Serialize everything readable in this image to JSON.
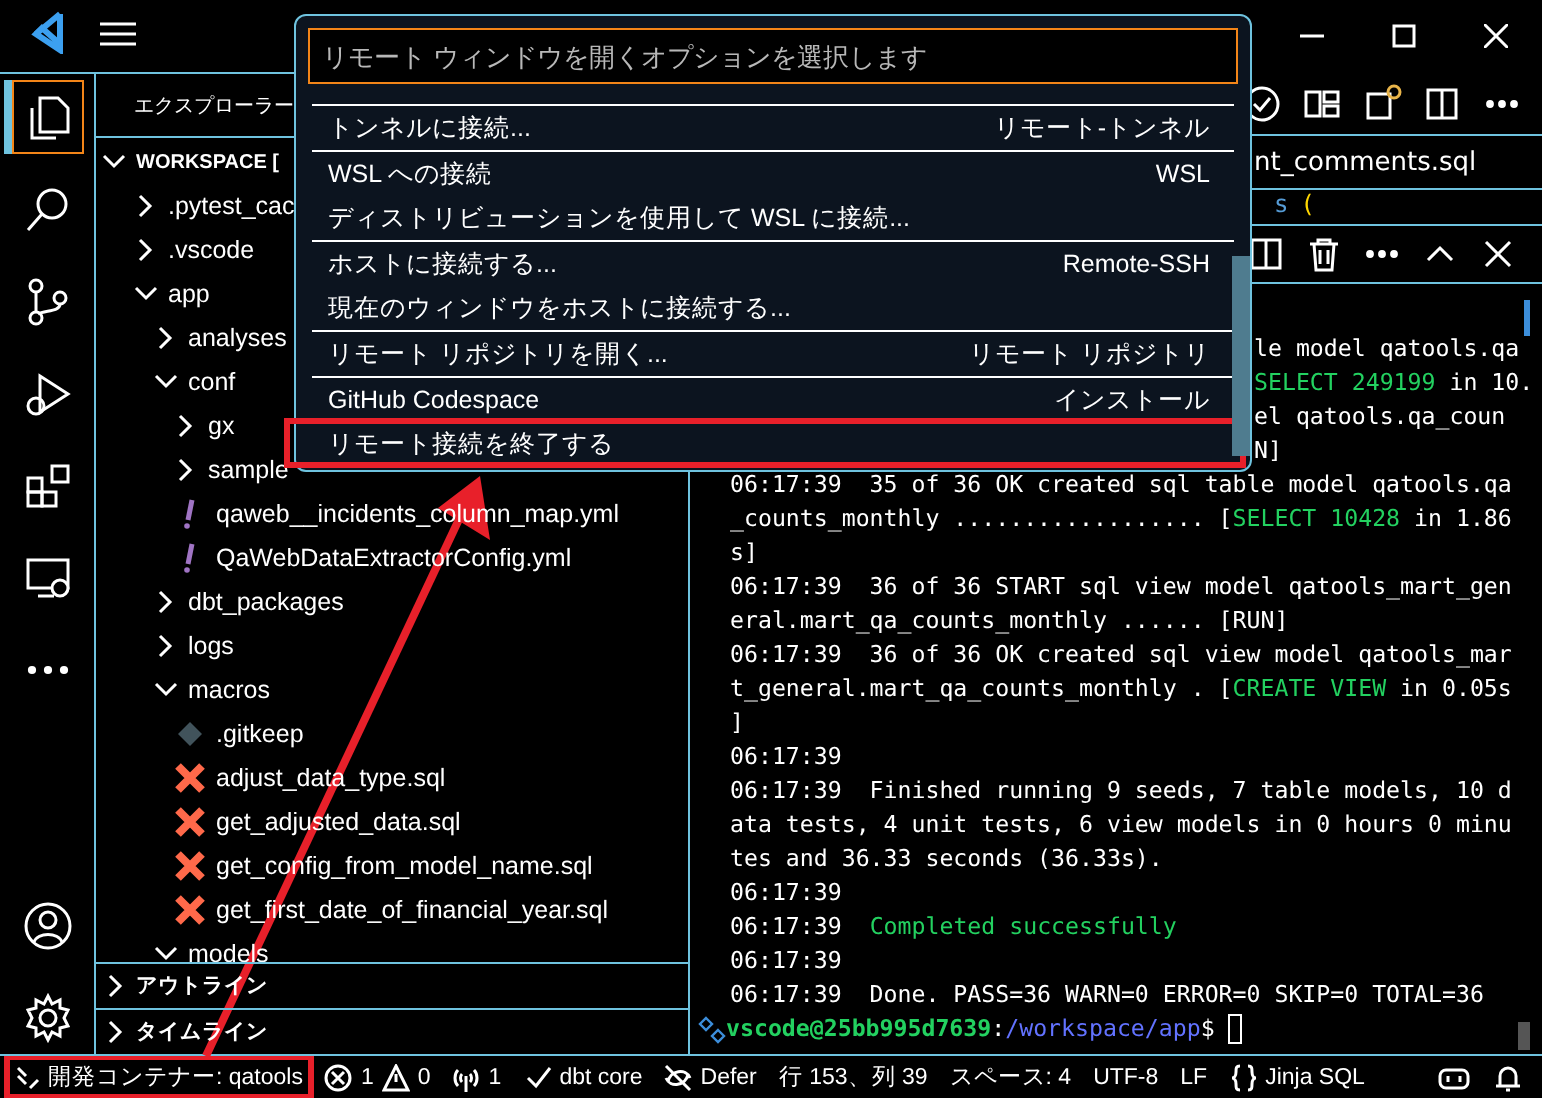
{
  "activity_bar": {
    "items": [
      {
        "kind": "explorer",
        "selected": true
      },
      {
        "kind": "search",
        "selected": false
      },
      {
        "kind": "source-control",
        "selected": false
      },
      {
        "kind": "run-debug",
        "selected": false
      },
      {
        "kind": "extensions",
        "selected": false
      },
      {
        "kind": "remote",
        "selected": false
      },
      {
        "kind": "more",
        "selected": false
      }
    ],
    "bottom": [
      {
        "kind": "account"
      },
      {
        "kind": "settings"
      }
    ]
  },
  "sidebar": {
    "title": "エクスプローラー",
    "tree": [
      {
        "label": "WORKSPACE [",
        "kind": "root",
        "expanded": true,
        "children": [
          {
            "label": ".pytest_cac",
            "kind": "folder",
            "expanded": false
          },
          {
            "label": ".vscode",
            "kind": "folder",
            "expanded": false
          },
          {
            "label": "app",
            "kind": "folder",
            "expanded": true,
            "children": [
              {
                "label": "analyses",
                "kind": "folder",
                "expanded": false
              },
              {
                "label": "conf",
                "kind": "folder",
                "expanded": true,
                "children": [
                  {
                    "label": "gx",
                    "kind": "folder",
                    "expanded": false
                  },
                  {
                    "label": "sample",
                    "kind": "folder",
                    "expanded": false
                  },
                  {
                    "label": "qaweb__incidents_column_map.yml",
                    "kind": "yaml"
                  },
                  {
                    "label": "QaWebDataExtractorConfig.yml",
                    "kind": "yaml"
                  }
                ]
              },
              {
                "label": "dbt_packages",
                "kind": "folder",
                "expanded": false
              },
              {
                "label": "logs",
                "kind": "folder",
                "expanded": false
              },
              {
                "label": "macros",
                "kind": "folder",
                "expanded": true,
                "children": [
                  {
                    "label": ".gitkeep",
                    "kind": "gitkeep"
                  },
                  {
                    "label": "adjust_data_type.sql",
                    "kind": "dbt"
                  },
                  {
                    "label": "get_adjusted_data.sql",
                    "kind": "dbt"
                  },
                  {
                    "label": "get_config_from_model_name.sql",
                    "kind": "dbt"
                  },
                  {
                    "label": "get_first_date_of_financial_year.sql",
                    "kind": "dbt"
                  }
                ]
              },
              {
                "label": "models",
                "kind": "folder",
                "expanded": true
              }
            ]
          }
        ]
      }
    ],
    "sections": [
      {
        "label": "アウトライン",
        "expanded": false
      },
      {
        "label": "タイムライン",
        "expanded": false
      }
    ]
  },
  "editor": {
    "tab": {
      "label": "nt_comments.sql"
    },
    "code": [
      {
        "text": "s",
        "kind": "keyword"
      },
      {
        "text": "(",
        "kind": "bracket"
      }
    ]
  },
  "terminal": {
    "lines": [
      {
        "clipped": true,
        "segments": [
          {
            "text": "le model qatools.qa",
            "kind": "plain"
          }
        ]
      },
      {
        "clipped": true,
        "segments": [
          {
            "text": "SELECT 249199",
            "kind": "success"
          },
          {
            "text": " in 10.",
            "kind": "plain"
          }
        ]
      },
      {
        "clipped": true,
        "segments": [
          {
            "text": "el qatools.qa_coun",
            "kind": "plain"
          }
        ]
      },
      {
        "clipped": true,
        "segments": [
          {
            "text": "N]",
            "kind": "plain"
          }
        ]
      },
      {
        "clipped": false,
        "segments": [
          {
            "text": "06:17:39  35 of 36 OK created sql table model qatools.qa",
            "kind": "plain"
          }
        ]
      },
      {
        "clipped": false,
        "segments": [
          {
            "text": "_counts_monthly .................. [",
            "kind": "plain"
          },
          {
            "text": "SELECT 10428",
            "kind": "success"
          },
          {
            "text": " in 1.86",
            "kind": "plain"
          }
        ]
      },
      {
        "clipped": false,
        "segments": [
          {
            "text": "s]",
            "kind": "plain"
          }
        ]
      },
      {
        "clipped": false,
        "segments": [
          {
            "text": "06:17:39  36 of 36 START sql view model qatools_mart_gen",
            "kind": "plain"
          }
        ]
      },
      {
        "clipped": false,
        "segments": [
          {
            "text": "eral.mart_qa_counts_monthly ...... [RUN]",
            "kind": "plain"
          }
        ]
      },
      {
        "clipped": false,
        "segments": [
          {
            "text": "06:17:39  36 of 36 OK created sql view model qatools_mar",
            "kind": "plain"
          }
        ]
      },
      {
        "clipped": false,
        "segments": [
          {
            "text": "t_general.mart_qa_counts_monthly . [",
            "kind": "plain"
          },
          {
            "text": "CREATE VIEW",
            "kind": "success"
          },
          {
            "text": " in 0.05s",
            "kind": "plain"
          }
        ]
      },
      {
        "clipped": false,
        "segments": [
          {
            "text": "]",
            "kind": "plain"
          }
        ]
      },
      {
        "clipped": false,
        "segments": [
          {
            "text": "06:17:39",
            "kind": "plain"
          }
        ]
      },
      {
        "clipped": false,
        "segments": [
          {
            "text": "06:17:39  Finished running 9 seeds, 7 table models, 10 d",
            "kind": "plain"
          }
        ]
      },
      {
        "clipped": false,
        "segments": [
          {
            "text": "ata tests, 4 unit tests, 6 view models in 0 hours 0 minu",
            "kind": "plain"
          }
        ]
      },
      {
        "clipped": false,
        "segments": [
          {
            "text": "tes and 36.33 seconds (36.33s).",
            "kind": "plain"
          }
        ]
      },
      {
        "clipped": false,
        "segments": [
          {
            "text": "06:17:39",
            "kind": "plain"
          }
        ]
      },
      {
        "clipped": false,
        "segments": [
          {
            "text": "06:17:39  ",
            "kind": "plain"
          },
          {
            "text": "Completed successfully",
            "kind": "success"
          }
        ]
      },
      {
        "clipped": false,
        "segments": [
          {
            "text": "06:17:39",
            "kind": "plain"
          }
        ]
      },
      {
        "clipped": false,
        "segments": [
          {
            "text": "06:17:39  Done. PASS=36 WARN=0 ERROR=0 SKIP=0 TOTAL=36",
            "kind": "plain"
          }
        ]
      }
    ],
    "prompt": [
      {
        "text": "vscode@25bb995d7639",
        "kind": "user"
      },
      {
        "text": ":",
        "kind": "plain"
      },
      {
        "text": "/workspace/app",
        "kind": "path"
      },
      {
        "text": "$",
        "kind": "plain"
      }
    ]
  },
  "quick_pick": {
    "placeholder": "リモート ウィンドウを開くオプションを選択します",
    "items": [
      {
        "label": "トンネルに接続...",
        "detail": "リモート-トンネル",
        "separator": true,
        "annotated": false
      },
      {
        "label": "WSL への接続",
        "detail": "WSL",
        "separator": true,
        "annotated": false
      },
      {
        "label": "ディストリビューションを使用して WSL に接続...",
        "separator": false,
        "annotated": false
      },
      {
        "label": "ホストに接続する...",
        "detail": "Remote-SSH",
        "separator": true,
        "annotated": false
      },
      {
        "label": "現在のウィンドウをホストに接続する...",
        "separator": false,
        "annotated": false
      },
      {
        "label": "リモート リポジトリを開く...",
        "detail": "リモート リポジトリ",
        "separator": true,
        "annotated": false
      },
      {
        "label": "GitHub Codespace",
        "detail": "インストール",
        "separator": true,
        "annotated": false
      },
      {
        "label": "リモート接続を終了する",
        "separator": false,
        "annotated": true
      }
    ]
  },
  "status_bar": {
    "items": [
      {
        "kind": "remote",
        "text": "開発コンテナー: qatools",
        "annotated": true
      },
      {
        "kind": "problems",
        "errors": "1",
        "warnings": "0"
      },
      {
        "kind": "ports",
        "text": "1"
      },
      {
        "kind": "check",
        "text": "dbt core"
      },
      {
        "kind": "defer",
        "text": "Defer"
      },
      {
        "kind": "text",
        "text": "行 153、列 39"
      },
      {
        "kind": "text",
        "text": "スペース: 4"
      },
      {
        "kind": "text",
        "text": "UTF-8"
      },
      {
        "kind": "text",
        "text": "LF"
      },
      {
        "kind": "language",
        "text": "Jinja SQL"
      },
      {
        "kind": "copilot"
      },
      {
        "kind": "bell"
      }
    ]
  },
  "annotation": {
    "arrow": true
  }
}
